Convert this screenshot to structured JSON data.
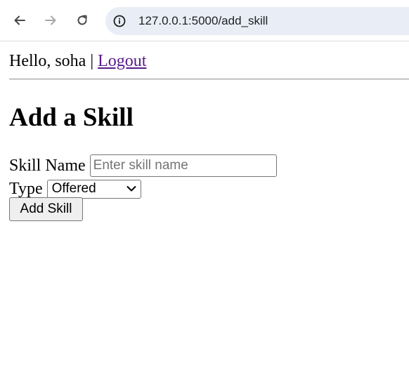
{
  "browser": {
    "url": "127.0.0.1:5000/add_skill",
    "icons": {
      "back": "arrow-left-icon",
      "forward": "arrow-right-icon",
      "reload": "reload-icon",
      "site_info": "info-circle-icon"
    }
  },
  "header": {
    "greeting": "Hello, soha",
    "separator": "|",
    "logout_label": "Logout"
  },
  "main": {
    "title": "Add a Skill",
    "form": {
      "skill_name_label": "Skill Name",
      "skill_name_value": "",
      "skill_name_placeholder": "Enter skill name",
      "type_label": "Type",
      "type_selected": "Offered",
      "submit_label": "Add Skill"
    }
  },
  "colors": {
    "link_visited": "#551a8b",
    "omnibox_bg": "#e9eef6"
  }
}
